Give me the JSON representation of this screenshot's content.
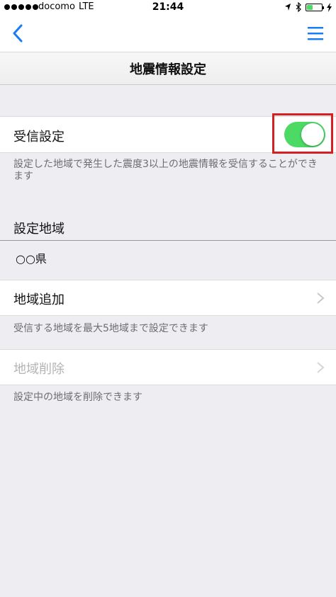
{
  "status_bar": {
    "carrier": "docomo",
    "network": "LTE",
    "time": "21:44"
  },
  "header": {
    "title": "地震情報設定"
  },
  "receive_setting": {
    "label": "受信設定",
    "toggle_on": true,
    "description": "設定した地域で発生した震度3以上の地震情報を受信することができます"
  },
  "region_section": {
    "header": "設定地域",
    "current_value": "○○県"
  },
  "add_region": {
    "label": "地域追加",
    "description": "受信する地域を最大5地域まで設定できます"
  },
  "delete_region": {
    "label": "地域削除",
    "enabled": false,
    "description": "設定中の地域を削除できます"
  },
  "colors": {
    "accent_blue": "#1a7cf5",
    "toggle_green": "#4cd964",
    "highlight_red": "#d42020",
    "background": "#eeedf2"
  }
}
